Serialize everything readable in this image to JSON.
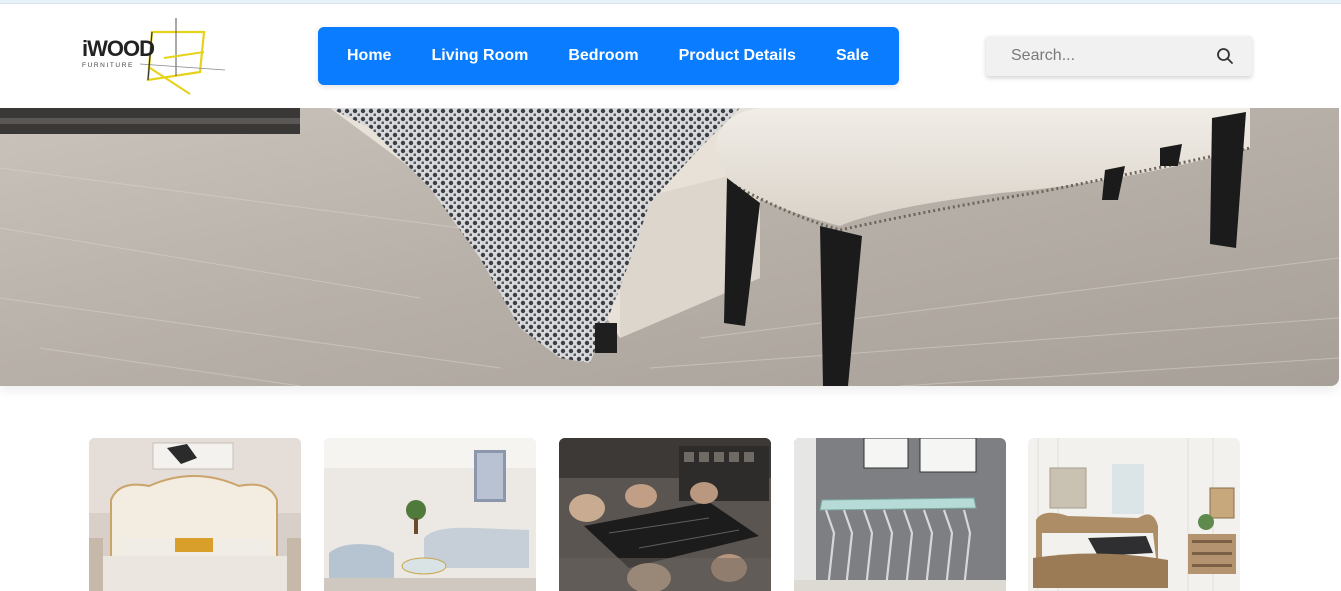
{
  "brand": {
    "name": "iWOOD",
    "tagline": "FURNITURE",
    "accent_color": "#e6d21a"
  },
  "nav": {
    "background_color": "#0a7cff",
    "items": [
      {
        "label": "Home"
      },
      {
        "label": "Living Room"
      },
      {
        "label": "Bedroom"
      },
      {
        "label": "Product Details"
      },
      {
        "label": "Sale"
      }
    ]
  },
  "search": {
    "placeholder": "Search...",
    "icon": "search-icon"
  },
  "hero": {
    "image": "bedroom-bench-carpet-photo"
  },
  "products": [
    {
      "image": "tufted-bed-photo"
    },
    {
      "image": "tufted-sofa-living-room-photo"
    },
    {
      "image": "marble-dining-table-photo"
    },
    {
      "image": "glass-console-table-photo"
    },
    {
      "image": "wooden-sleigh-bed-photo"
    }
  ]
}
